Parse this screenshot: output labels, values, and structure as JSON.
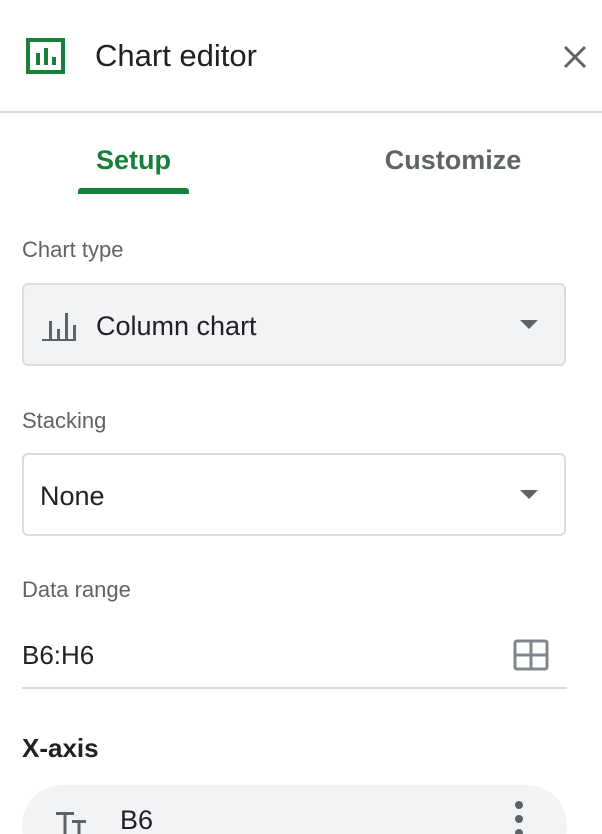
{
  "header": {
    "title": "Chart editor",
    "logo_icon": "chart-logo-icon",
    "close_icon": "close-icon"
  },
  "tabs": [
    {
      "label": "Setup",
      "active": true
    },
    {
      "label": "Customize",
      "active": false
    }
  ],
  "chart_type": {
    "label": "Chart type",
    "value": "Column chart",
    "icon": "column-chart-icon"
  },
  "stacking": {
    "label": "Stacking",
    "value": "None"
  },
  "data_range": {
    "label": "Data range",
    "value": "B6:H6",
    "icon": "grid-select-icon"
  },
  "x_axis": {
    "title": "X-axis",
    "item": "B6",
    "item_icon": "text-type-icon",
    "menu_icon": "more-vert-icon"
  },
  "colors": {
    "accent": "#188038",
    "text": "#202124",
    "muted": "#5f6368",
    "border": "#dadce0",
    "field_bg": "#f1f3f4"
  }
}
